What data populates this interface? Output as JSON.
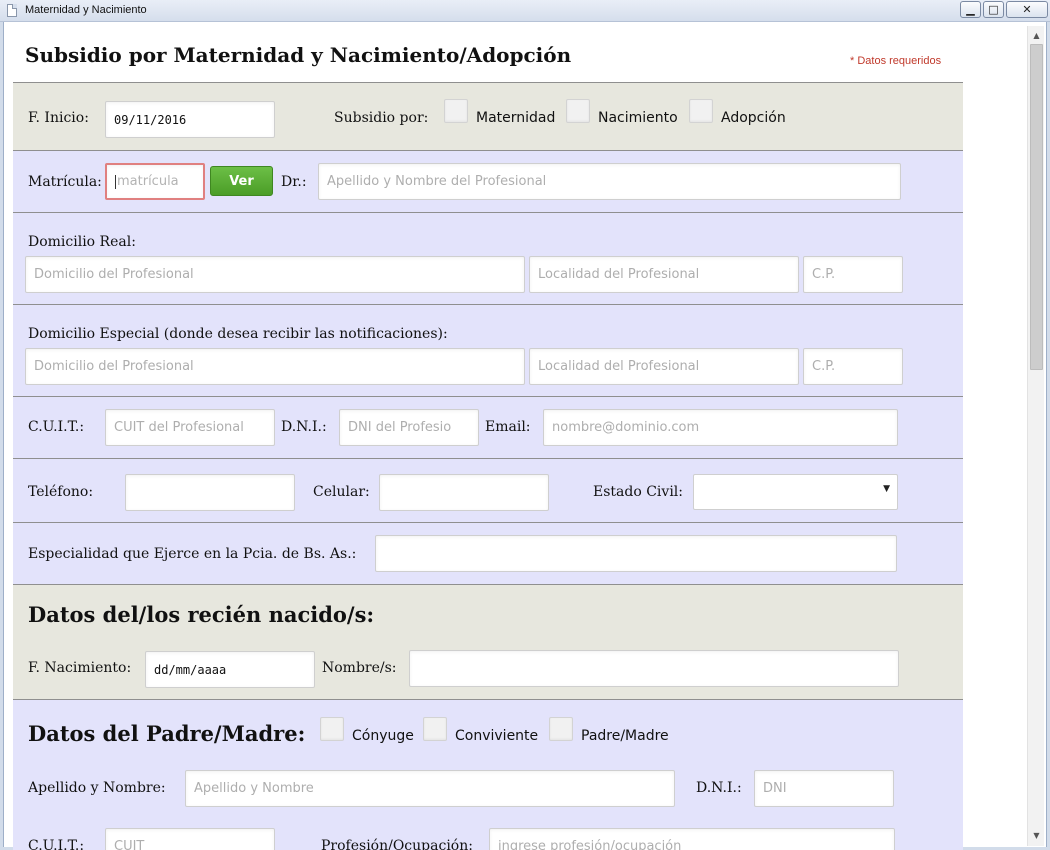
{
  "window": {
    "title": "Maternidad y Nacimiento",
    "minimize": "▁",
    "maximize": "□",
    "close": "✕"
  },
  "scrollbar": {
    "up": "▲",
    "down": "▼"
  },
  "page": {
    "title": "Subsidio por Maternidad y Nacimiento/Adopción",
    "required_note": "* Datos requeridos"
  },
  "row_inicio": {
    "fecha_label": "F. Inicio:",
    "fecha_value": "09/11/2016",
    "subsidio_label": "Subsidio por:",
    "options": [
      "Maternidad",
      "Nacimiento",
      "Adopción"
    ]
  },
  "row_matricula": {
    "matricula_label": "Matrícula:",
    "matricula_placeholder": "matrícula",
    "ver_button": "Ver",
    "dr_label": "Dr.:",
    "dr_placeholder": "Apellido y Nombre del Profesional"
  },
  "domicilio_real": {
    "label": "Domicilio Real:",
    "domicilio_placeholder": "Domicilio del Profesional",
    "localidad_placeholder": "Localidad del Profesional",
    "cp_placeholder": "C.P."
  },
  "domicilio_especial": {
    "label": "Domicilio Especial (donde desea recibir las notificaciones):",
    "domicilio_placeholder": "Domicilio del Profesional",
    "localidad_placeholder": "Localidad del Profesional",
    "cp_placeholder": "C.P."
  },
  "row_cuit": {
    "cuit_label": "C.U.I.T.:",
    "cuit_placeholder": "CUIT del Profesional",
    "dni_label": "D.N.I.:",
    "dni_placeholder": "DNI del Profesio",
    "email_label": "Email:",
    "email_placeholder": "nombre@dominio.com"
  },
  "row_telefono": {
    "telefono_label": "Teléfono:",
    "celular_label": "Celular:",
    "estado_label": "Estado Civil:",
    "estado_value": ""
  },
  "row_especialidad": {
    "label": "Especialidad que Ejerce en la Pcia. de Bs. As.:"
  },
  "recien_nacidos": {
    "heading": "Datos del/los recién nacido/s:",
    "fecha_label": "F. Nacimiento:",
    "fecha_value": "dd/mm/aaaa",
    "nombre_label": "Nombre/s:"
  },
  "padre_madre": {
    "heading": "Datos del Padre/Madre:",
    "options": [
      "Cónyuge",
      "Conviviente",
      "Padre/Madre"
    ],
    "apellido_label": "Apellido y Nombre:",
    "apellido_placeholder": "Apellido y Nombre",
    "dni_label": "D.N.I.:",
    "dni_placeholder": "DNI",
    "cuit_label": "C.U.I.T.:",
    "cuit_placeholder": "CUIT",
    "profesion_label": "Profesión/Ocupación:",
    "profesion_placeholder": "ingrese profesión/ocupación"
  }
}
